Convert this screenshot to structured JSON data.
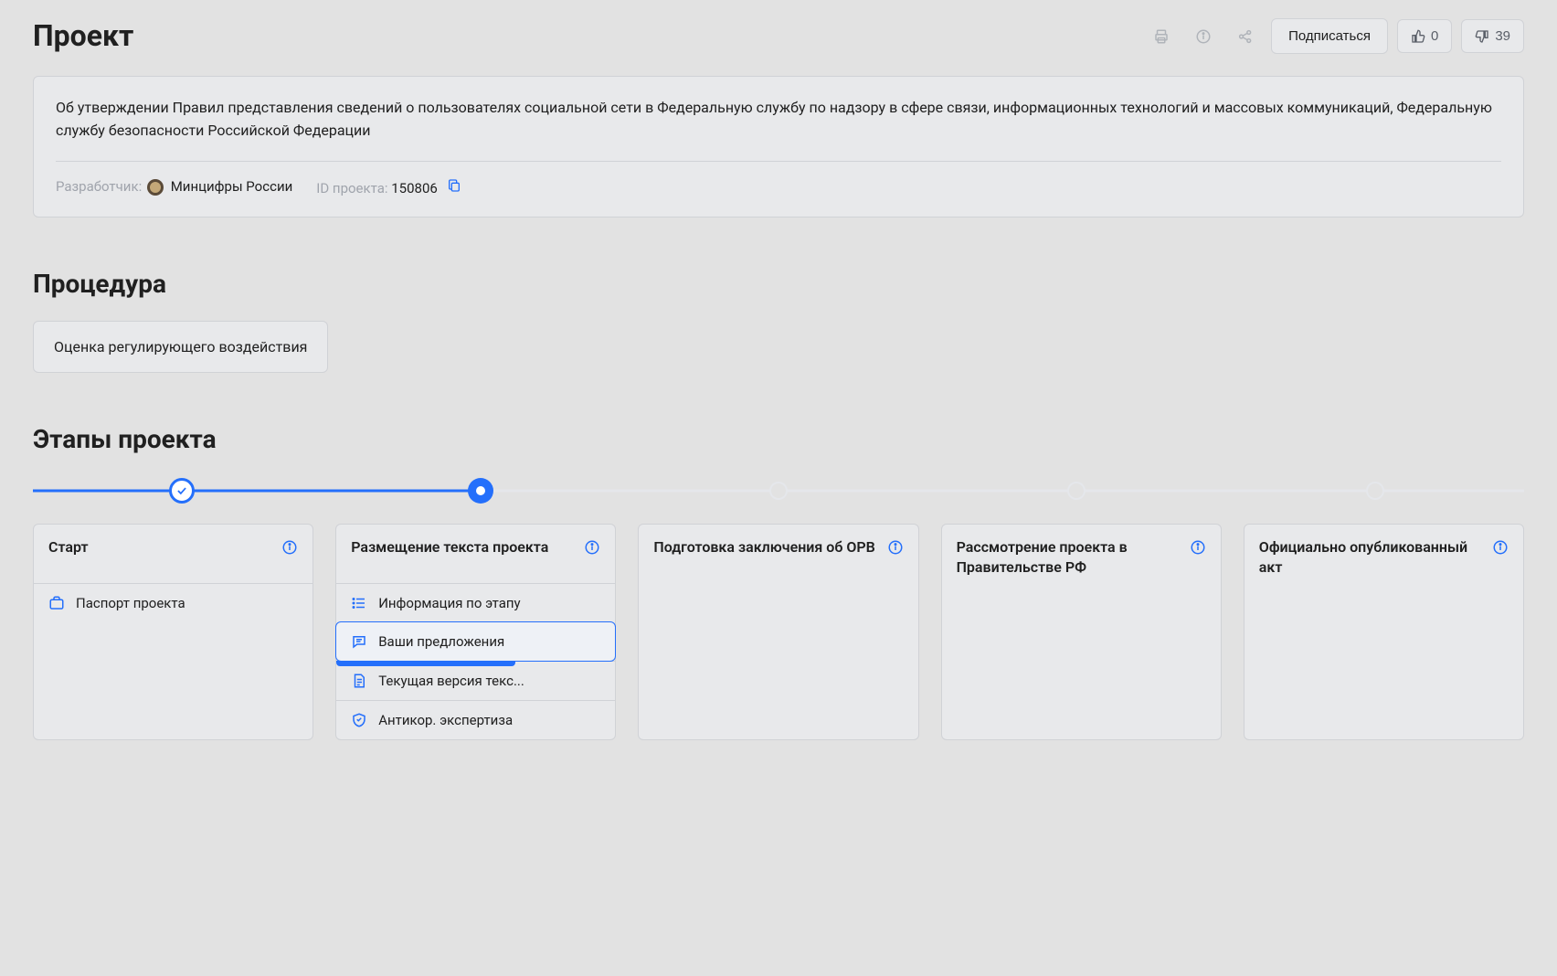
{
  "header": {
    "title": "Проект",
    "subscribe_label": "Подписаться",
    "like_count": "0",
    "dislike_count": "39"
  },
  "project_card": {
    "description": "Об утверждении Правил представления сведений о пользователях социальной сети в Федеральную службу по надзору в сфере связи, информационных технологий и массовых коммуникаций, Федеральную службу безопасности Российской Федерации",
    "developer_label": "Разработчик:",
    "developer_value": "Минцифры России",
    "id_label": "ID проекта:",
    "id_value": "150806"
  },
  "procedure": {
    "heading": "Процедура",
    "value": "Оценка регулирующего воздействия"
  },
  "stages_section": {
    "heading": "Этапы проекта"
  },
  "stages": [
    {
      "title": "Старт",
      "items": [
        {
          "icon": "briefcase-icon",
          "label": "Паспорт проекта"
        }
      ]
    },
    {
      "title": "Размещение текста проекта",
      "items": [
        {
          "icon": "list-icon",
          "label": "Информация по этапу"
        },
        {
          "icon": "comment-icon",
          "label": "Ваши предложения"
        },
        {
          "icon": "document-icon",
          "label": "Текущая версия текс..."
        },
        {
          "icon": "shield-icon",
          "label": "Антикор. экспертиза"
        }
      ]
    },
    {
      "title": "Подготовка заключения об ОРВ"
    },
    {
      "title": "Рассмотрение проекта в Правительстве РФ"
    },
    {
      "title": "Официально опубликованный акт"
    }
  ]
}
